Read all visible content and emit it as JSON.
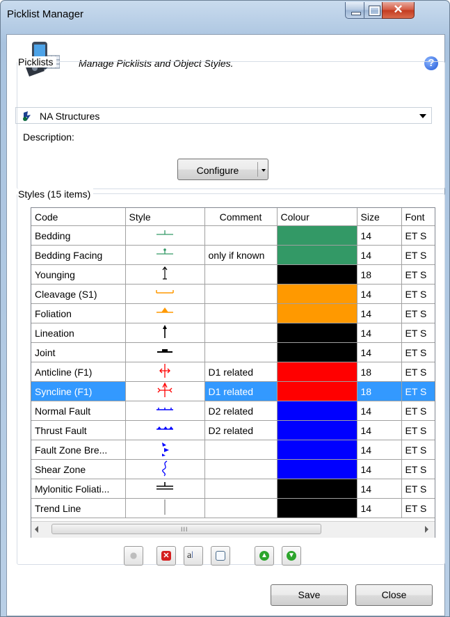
{
  "window": {
    "title": "Picklist Manager"
  },
  "header": {
    "subtitle": "Manage Picklists and Object Styles."
  },
  "picklists": {
    "group_label": "Picklists",
    "selected": "NA Structures",
    "description_label": "Description:",
    "configure_label": "Configure"
  },
  "styles": {
    "group_label": "Styles (15 items)",
    "columns": [
      "Code",
      "Style",
      "Comment",
      "Colour",
      "Size",
      "Font"
    ],
    "rows": [
      {
        "code": "Bedding",
        "comment": "",
        "colour": "#339966",
        "size": "14",
        "font": "ET S",
        "symbol": "bedding-symbol-icon"
      },
      {
        "code": "Bedding Facing",
        "comment": "only if known",
        "colour": "#339966",
        "size": "14",
        "font": "ET S",
        "symbol": "bedding-facing-symbol-icon"
      },
      {
        "code": "Younging",
        "comment": "",
        "colour": "#000000",
        "size": "18",
        "font": "ET S",
        "symbol": "younging-symbol-icon"
      },
      {
        "code": "Cleavage (S1)",
        "comment": "",
        "colour": "#ff9900",
        "size": "14",
        "font": "ET S",
        "symbol": "cleavage-symbol-icon"
      },
      {
        "code": "Foliation",
        "comment": "",
        "colour": "#ff9900",
        "size": "14",
        "font": "ET S",
        "symbol": "foliation-symbol-icon"
      },
      {
        "code": "Lineation",
        "comment": "",
        "colour": "#000000",
        "size": "14",
        "font": "ET S",
        "symbol": "lineation-symbol-icon"
      },
      {
        "code": "Joint",
        "comment": "",
        "colour": "#000000",
        "size": "14",
        "font": "ET S",
        "symbol": "joint-symbol-icon"
      },
      {
        "code": "Anticline (F1)",
        "comment": "D1 related",
        "colour": "#ff0000",
        "size": "18",
        "font": "ET S",
        "symbol": "anticline-symbol-icon"
      },
      {
        "code": "Syncline (F1)",
        "comment": "D1 related",
        "colour": "#ff0000",
        "size": "18",
        "font": "ET S",
        "symbol": "syncline-symbol-icon"
      },
      {
        "code": "Normal Fault",
        "comment": "D2 related",
        "colour": "#0000ff",
        "size": "14",
        "font": "ET S",
        "symbol": "normal-fault-symbol-icon"
      },
      {
        "code": "Thrust Fault",
        "comment": "D2 related",
        "colour": "#0000ff",
        "size": "14",
        "font": "ET S",
        "symbol": "thrust-fault-symbol-icon"
      },
      {
        "code": "Fault Zone Bre...",
        "comment": "",
        "colour": "#0000ff",
        "size": "14",
        "font": "ET S",
        "symbol": "fault-zone-symbol-icon"
      },
      {
        "code": "Shear Zone",
        "comment": "",
        "colour": "#0000ff",
        "size": "14",
        "font": "ET S",
        "symbol": "shear-zone-symbol-icon"
      },
      {
        "code": "Mylonitic Foliati...",
        "comment": "",
        "colour": "#000000",
        "size": "14",
        "font": "ET S",
        "symbol": "mylonitic-symbol-icon"
      },
      {
        "code": "Trend Line",
        "comment": "",
        "colour": "#000000",
        "size": "14",
        "font": "ET S",
        "symbol": "trend-line-symbol-icon"
      }
    ],
    "selected_row": 8,
    "hscroll_grip": "III"
  },
  "toolbar": {
    "icons": [
      "add-icon",
      "delete-icon",
      "font-icon",
      "edit-icon",
      "move-up-icon",
      "move-down-icon"
    ]
  },
  "buttons": {
    "save": "Save",
    "close": "Close"
  },
  "colors": {
    "selection": "#3399ff",
    "chrome": "#b9cfe6"
  }
}
